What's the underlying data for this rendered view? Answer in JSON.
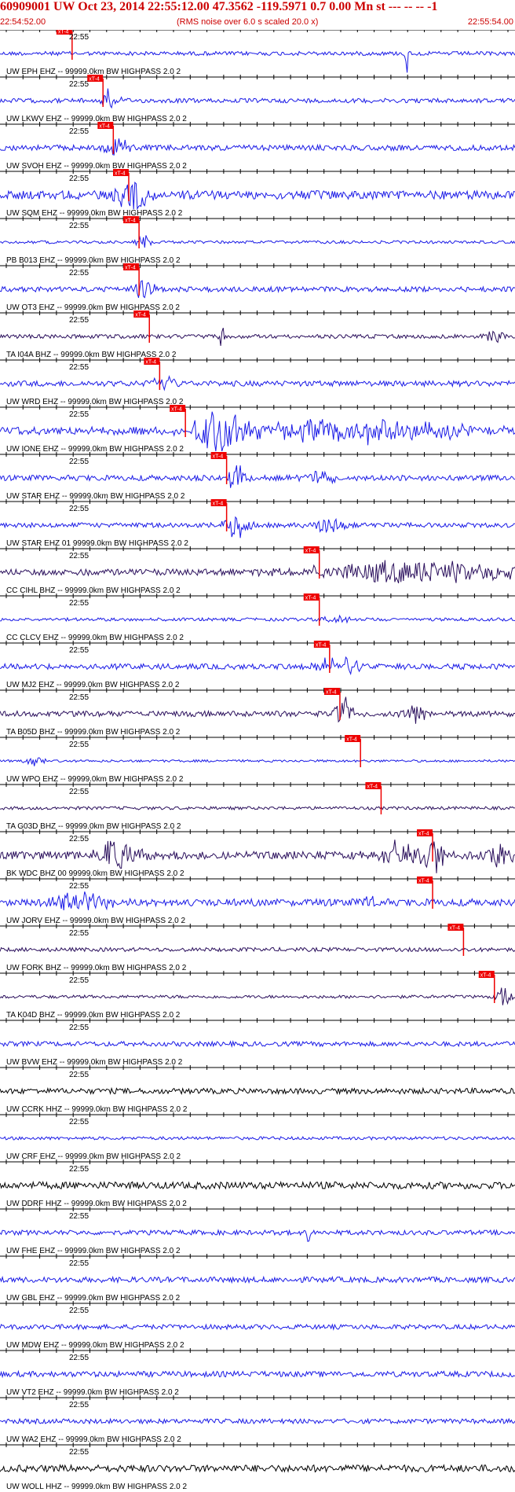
{
  "header": {
    "title": "60909001 UW Oct 23, 2014 22:55:12.00   47.3562 -119.5971  0.7 0.00 Mn st --- -- --   -1",
    "start_time": "22:54:52.00",
    "noise_note": "(RMS noise over 6.0 s scaled 20.0 x)",
    "end_time": "22:55:54.00"
  },
  "chart_data": {
    "type": "seismogram",
    "time_start": "22:54:52.00",
    "time_end": "22:55:54.00",
    "tick_time_label": "22:55",
    "pick_label": "xT-4",
    "colors": {
      "blue": "#1a1ae6",
      "purple": "#2a0f5c",
      "black": "#000000",
      "pick": "#ee0000",
      "grid": "#000000"
    },
    "traces": [
      {
        "label": "UW EPH  EHZ -- 99999.0km BW  HIGHPASS  2.0  2",
        "color": "blue",
        "noise": 0.25,
        "pick_frac": 0.14,
        "bursts": [
          {
            "t": 0.79,
            "a": 1.9,
            "w": 0.003
          }
        ]
      },
      {
        "label": "UW LKWV EHZ -- 99999.0km BW  HIGHPASS  2.0  2",
        "color": "blue",
        "noise": 0.28,
        "pick_frac": 0.2,
        "bursts": [
          {
            "t": 0.21,
            "a": 1.0,
            "w": 0.02
          }
        ]
      },
      {
        "label": "UW SVOH EHZ -- 99999.0km BW  HIGHPASS  2.0  2",
        "color": "blue",
        "noise": 0.35,
        "pick_frac": 0.22,
        "bursts": [
          {
            "t": 0.23,
            "a": 0.9,
            "w": 0.025
          }
        ]
      },
      {
        "label": "UW SQM  EHZ -- 99999.0km BW  HIGHPASS  2.0  2",
        "color": "blue",
        "noise": 0.55,
        "pick_frac": 0.25,
        "bursts": [
          {
            "t": 0.26,
            "a": 1.6,
            "w": 0.03
          }
        ]
      },
      {
        "label": "PB B013 EHZ -- 99999.0km BW  HIGHPASS  2.0  2",
        "color": "blue",
        "noise": 0.18,
        "pick_frac": 0.27,
        "bursts": [
          {
            "t": 0.28,
            "a": 0.7,
            "w": 0.015
          }
        ]
      },
      {
        "label": "UW OT3  EHZ -- 99999.0km BW  HIGHPASS  2.0  2",
        "color": "blue",
        "noise": 0.32,
        "pick_frac": 0.27,
        "bursts": [
          {
            "t": 0.28,
            "a": 0.9,
            "w": 0.02
          }
        ]
      },
      {
        "label": "TA I04A BHZ -- 99999.0km BW  HIGHPASS  2.0  2",
        "color": "purple",
        "noise": 0.25,
        "pick_frac": 0.29,
        "bursts": [
          {
            "t": 0.43,
            "a": 1.1,
            "w": 0.006
          },
          {
            "t": 0.96,
            "a": 0.5,
            "w": 0.02
          }
        ]
      },
      {
        "label": "UW WRD  EHZ -- 99999.0km BW  HIGHPASS  2.0  2",
        "color": "blue",
        "noise": 0.35,
        "pick_frac": 0.31,
        "bursts": [
          {
            "t": 0.32,
            "a": 0.9,
            "w": 0.02
          }
        ]
      },
      {
        "label": "UW IONE EHZ -- 99999.0km BW  HIGHPASS  2.0  2",
        "color": "blue",
        "noise": 0.5,
        "pick_frac": 0.36,
        "bursts": [
          {
            "t": 0.43,
            "a": 2.2,
            "w": 0.05
          },
          {
            "t": 0.7,
            "a": 1.0,
            "w": 0.2
          }
        ]
      },
      {
        "label": "UW STAR EHZ -- 99999.0km BW  HIGHPASS  2.0  2",
        "color": "blue",
        "noise": 0.35,
        "pick_frac": 0.44,
        "bursts": [
          {
            "t": 0.46,
            "a": 1.2,
            "w": 0.02
          },
          {
            "t": 0.62,
            "a": 0.6,
            "w": 0.03
          }
        ]
      },
      {
        "label": "UW STAR EHZ 01 99999.0km BW  HIGHPASS  2.0  2",
        "color": "blue",
        "noise": 0.3,
        "pick_frac": 0.44,
        "bursts": [
          {
            "t": 0.46,
            "a": 1.4,
            "w": 0.02
          },
          {
            "t": 0.64,
            "a": 0.7,
            "w": 0.03
          }
        ]
      },
      {
        "label": "CC CIHL BHZ -- 99999.0km BW  HIGHPASS  2.0  2",
        "color": "purple",
        "noise": 0.4,
        "pick_frac": 0.62,
        "bursts": [
          {
            "t": 0.8,
            "a": 1.0,
            "w": 0.2
          }
        ]
      },
      {
        "label": "CC CLCV EHZ -- 99999.0km BW  HIGHPASS  2.0  2",
        "color": "blue",
        "noise": 0.2,
        "pick_frac": 0.62,
        "bursts": [
          {
            "t": 0.66,
            "a": 0.4,
            "w": 0.03
          }
        ]
      },
      {
        "label": "UW MJ2  EHZ -- 99999.0km BW  HIGHPASS  2.0  2",
        "color": "blue",
        "noise": 0.35,
        "pick_frac": 0.64,
        "bursts": [
          {
            "t": 0.66,
            "a": 1.0,
            "w": 0.04
          }
        ]
      },
      {
        "label": "TA B05D BHZ -- 99999.0km BW  HIGHPASS  2.0  2",
        "color": "purple",
        "noise": 0.35,
        "pick_frac": 0.66,
        "bursts": [
          {
            "t": 0.67,
            "a": 1.5,
            "w": 0.02
          },
          {
            "t": 0.81,
            "a": 0.8,
            "w": 0.03
          }
        ]
      },
      {
        "label": "UW WPO  EHZ -- 99999.0km BW  HIGHPASS  2.0  2",
        "color": "blue",
        "noise": 0.15,
        "pick_frac": 0.7,
        "bursts": [
          {
            "t": 0.07,
            "a": 0.5,
            "w": 0.02
          }
        ]
      },
      {
        "label": "TA G03D BHZ -- 99999.0km BW  HIGHPASS  2.0  2",
        "color": "purple",
        "noise": 0.2,
        "pick_frac": 0.74,
        "bursts": []
      },
      {
        "label": "BK WDC  BHZ 00 99999.0km BW  HIGHPASS  2.0  2",
        "color": "purple",
        "noise": 0.5,
        "pick_frac": 0.84,
        "bursts": [
          {
            "t": 0.23,
            "a": 1.5,
            "w": 0.04
          },
          {
            "t": 0.78,
            "a": 1.2,
            "w": 0.05
          },
          {
            "t": 0.84,
            "a": 2.0,
            "w": 0.02
          },
          {
            "t": 0.97,
            "a": 1.6,
            "w": 0.02
          }
        ]
      },
      {
        "label": "UW JORV EHZ -- 99999.0km BW  HIGHPASS  2.0  2",
        "color": "blue",
        "noise": 0.45,
        "pick_frac": 0.84,
        "bursts": [
          {
            "t": 0.15,
            "a": 0.9,
            "w": 0.06
          },
          {
            "t": 0.72,
            "a": 0.6,
            "w": 0.01
          }
        ]
      },
      {
        "label": "UW FORK BHZ -- 99999.0km BW  HIGHPASS  2.0  2",
        "color": "purple",
        "noise": 0.25,
        "pick_frac": 0.9,
        "bursts": []
      },
      {
        "label": "TA K04D BHZ -- 99999.0km BW  HIGHPASS  2.0  2",
        "color": "purple",
        "noise": 0.2,
        "pick_frac": 0.96,
        "bursts": [
          {
            "t": 0.98,
            "a": 1.0,
            "w": 0.015
          }
        ]
      },
      {
        "label": "UW BVW  EHZ -- 99999.0km BW  HIGHPASS  2.0  2",
        "color": "blue",
        "noise": 0.3,
        "pick_frac": null,
        "bursts": []
      },
      {
        "label": "UW CCRK HHZ -- 99999.0km BW  HIGHPASS  2.0  2",
        "color": "black",
        "noise": 0.35,
        "pick_frac": null,
        "bursts": []
      },
      {
        "label": "UW CRF  EHZ -- 99999.0km BW  HIGHPASS  2.0  2",
        "color": "blue",
        "noise": 0.2,
        "pick_frac": null,
        "bursts": []
      },
      {
        "label": "UW DDRF HHZ -- 99999.0km BW  HIGHPASS  2.0  2",
        "color": "black",
        "noise": 0.45,
        "pick_frac": null,
        "bursts": []
      },
      {
        "label": "UW FHE  EHZ -- 99999.0km BW  HIGHPASS  2.0  2",
        "color": "blue",
        "noise": 0.3,
        "pick_frac": null,
        "bursts": [
          {
            "t": 0.6,
            "a": 1.2,
            "w": 0.004
          }
        ]
      },
      {
        "label": "UW GBL  EHZ -- 99999.0km BW  HIGHPASS  2.0  2",
        "color": "blue",
        "noise": 0.35,
        "pick_frac": null,
        "bursts": []
      },
      {
        "label": "UW MDW  EHZ -- 99999.0km BW  HIGHPASS  2.0  2",
        "color": "blue",
        "noise": 0.3,
        "pick_frac": null,
        "bursts": []
      },
      {
        "label": "UW VT2  EHZ -- 99999.0km BW  HIGHPASS  2.0  2",
        "color": "blue",
        "noise": 0.35,
        "pick_frac": null,
        "bursts": []
      },
      {
        "label": "UW WA2  EHZ -- 99999.0km BW  HIGHPASS  2.0  2",
        "color": "blue",
        "noise": 0.3,
        "pick_frac": null,
        "bursts": []
      },
      {
        "label": "UW WOLL HHZ -- 99999.0km BW  HIGHPASS  2.0  2",
        "color": "black",
        "noise": 0.45,
        "pick_frac": null,
        "bursts": []
      }
    ]
  }
}
